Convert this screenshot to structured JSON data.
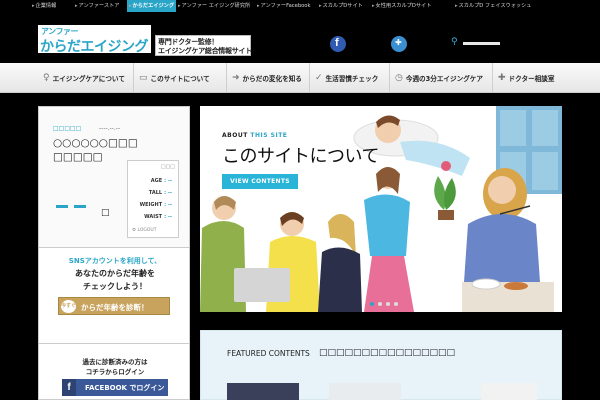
{
  "topbar": {
    "links": [
      "企業情報",
      "アンファーストア",
      "からだエイジング",
      "アンファー エイジング研究所",
      "アンファーFacebook",
      "スカルプDサイト",
      "女性用スカルプDサイト",
      "スカルプD フェイスウォッシュ"
    ]
  },
  "header": {
    "logo_small": "アンファー",
    "logo_main": "からだエイジング",
    "tagline_1": "専門ドクター監修！",
    "tagline_2": "エイジングケア総合情報サイト"
  },
  "nav": {
    "items": [
      "エイジングケアについて",
      "このサイトについて",
      "からだの変化を知る",
      "生活習慣チェック",
      "今週の3分エイジングケア",
      "ドクター相談室"
    ]
  },
  "sidebar": {
    "profile": {
      "tag": "□□□□□",
      "date": "----.--.--",
      "name_1": "○○○○○○□□□",
      "name_2": "□□□□□",
      "square": "□",
      "stats_close": "□□□",
      "stats": [
        {
          "label": "AGE",
          "value": ": --"
        },
        {
          "label": "TALL",
          "value": ": --"
        },
        {
          "label": "WEIGHT",
          "value": ": --"
        },
        {
          "label": "WAIST",
          "value": ": --"
        }
      ],
      "logout": "LOGOUT"
    },
    "sns": {
      "line_1": "SNSアカウントを利用して、",
      "line_2": "あなたのからだ年齢を",
      "line_3": "チェックしよう！",
      "diag_prefix": "今すぐ",
      "diag_button": "からだ年齢を診断！"
    },
    "facebook": {
      "line_1": "過去に診断済みの方は",
      "line_2": "コチラからログイン",
      "button": "FACEBOOK でログイン"
    }
  },
  "hero": {
    "about": "ABOUT",
    "this_site": "THIS SITE",
    "title": "このサイトについて",
    "button": "VIEW CONTENTS",
    "slide_count": 4,
    "active_slide": 1
  },
  "featured": {
    "heading": "FEATURED CONTENTS",
    "subheading": "□□□□□□□□□□□□□□□□"
  },
  "colors": {
    "accent": "#2aa5c8",
    "gold": "#c8a35e",
    "facebook": "#3b5998"
  }
}
